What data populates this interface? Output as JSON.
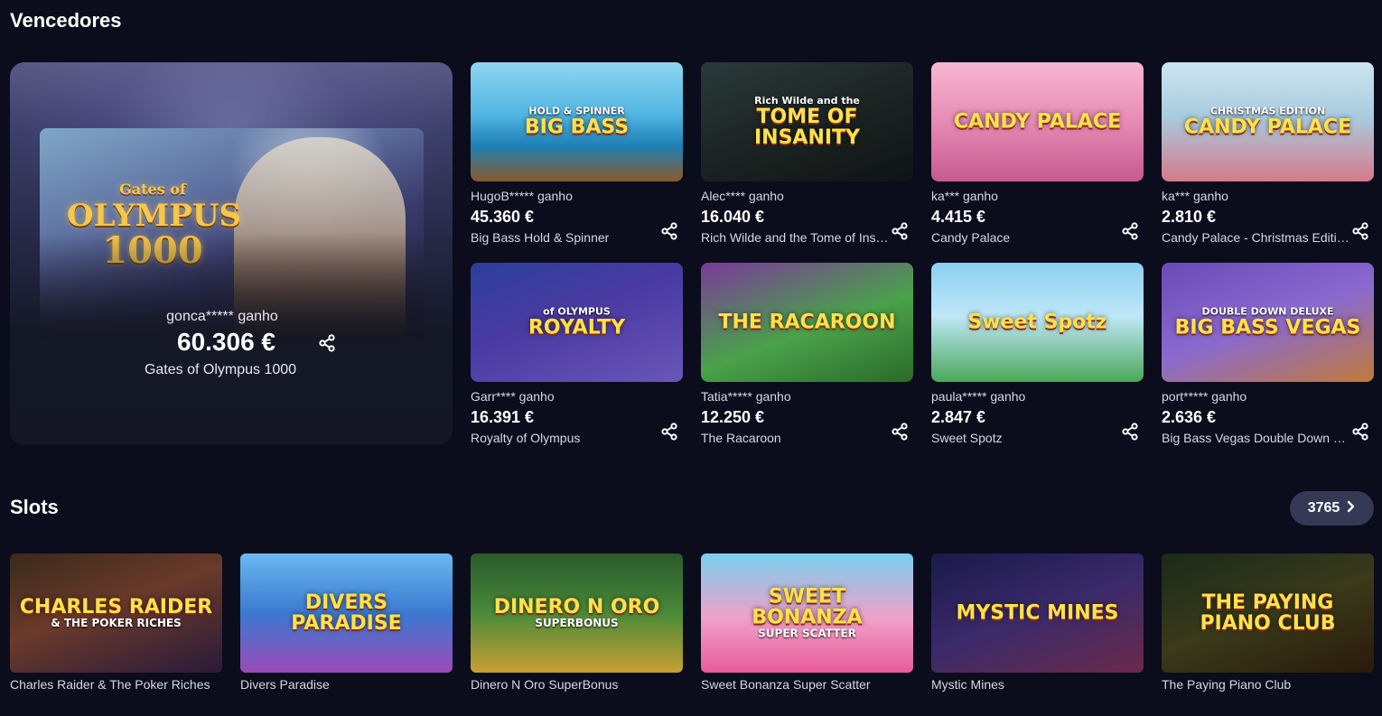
{
  "winners": {
    "title": "Vencedores",
    "featured": {
      "player": "gonca***** ganho",
      "amount": "60.306 €",
      "game": "Gates of Olympus 1000",
      "logo_line1": "Gates of",
      "logo_line2": "OLYMPUS",
      "logo_line3": "1000"
    },
    "cards": [
      {
        "player": "HugoB***** ganho",
        "amount": "45.360 €",
        "game": "Big Bass Hold & Spinner",
        "art": "BIG BASS",
        "art_sub": "HOLD & SPINNER"
      },
      {
        "player": "Alec**** ganho",
        "amount": "16.040 €",
        "game": "Rich Wilde and the Tome of Insanity",
        "art": "TOME OF INSANITY",
        "art_sub": "Rich Wilde and the"
      },
      {
        "player": "ka*** ganho",
        "amount": "4.415 €",
        "game": "Candy Palace",
        "art": "CANDY PALACE",
        "art_sub": ""
      },
      {
        "player": "ka*** ganho",
        "amount": "2.810 €",
        "game": "Candy Palace - Christmas Edition",
        "art": "CANDY PALACE",
        "art_sub": "CHRISTMAS EDITION"
      },
      {
        "player": "Garr**** ganho",
        "amount": "16.391 €",
        "game": "Royalty of Olympus",
        "art": "ROYALTY",
        "art_sub": "of OLYMPUS"
      },
      {
        "player": "Tatia***** ganho",
        "amount": "12.250 €",
        "game": "The Racaroon",
        "art": "THE RACAROON",
        "art_sub": ""
      },
      {
        "player": "paula***** ganho",
        "amount": "2.847 €",
        "game": "Sweet Spotz",
        "art": "Sweet Spotz",
        "art_sub": ""
      },
      {
        "player": "port***** ganho",
        "amount": "2.636 €",
        "game": "Big Bass Vegas Double Down Deluxe",
        "art": "BIG BASS VEGAS",
        "art_sub": "DOUBLE DOWN DELUXE"
      }
    ]
  },
  "slots": {
    "title": "Slots",
    "count": "3765",
    "games": [
      {
        "name": "Charles Raider & The Poker Riches",
        "art": "CHARLES RAIDER",
        "art_sub": "& THE POKER RICHES"
      },
      {
        "name": "Divers Paradise",
        "art": "DIVERS PARADISE",
        "art_sub": ""
      },
      {
        "name": "Dinero N Oro SuperBonus",
        "art": "DINERO N ORO",
        "art_sub": "SUPERBONUS"
      },
      {
        "name": "Sweet Bonanza Super Scatter",
        "art": "SWEET BONANZA",
        "art_sub": "SUPER SCATTER"
      },
      {
        "name": "Mystic Mines",
        "art": "MYSTIC MINES",
        "art_sub": ""
      },
      {
        "name": "The Paying Piano Club",
        "art": "THE PAYING PIANO CLUB",
        "art_sub": ""
      }
    ]
  },
  "colors": {
    "background": "#0b0c1c",
    "count_button": "#343a55"
  },
  "icons": {
    "share": "share-icon",
    "chevron": "chevron-right-icon"
  }
}
